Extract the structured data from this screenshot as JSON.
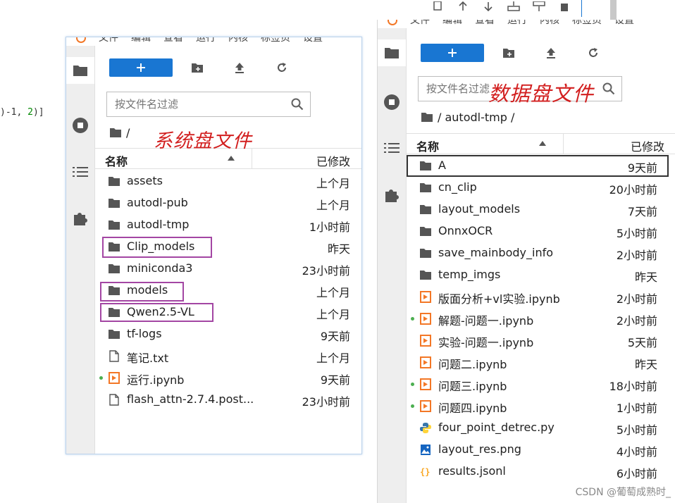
{
  "background": {
    "code_fragment_prefix": ")-1, ",
    "code_fragment_num": "2",
    "code_fragment_suffix": ")]"
  },
  "menu_labels": [
    "文件",
    "编辑",
    "查看",
    "运行",
    "内核",
    "标签页",
    "设置"
  ],
  "left_panel": {
    "filter_placeholder": "按文件名过滤",
    "breadcrumb": "/",
    "annotation": "系统盘文件",
    "column_name": "名称",
    "column_modified": "已修改",
    "rows": [
      {
        "name": "assets",
        "modified": "上个月",
        "type": "folder",
        "running": false
      },
      {
        "name": "autodl-pub",
        "modified": "上个月",
        "type": "folder",
        "running": false
      },
      {
        "name": "autodl-tmp",
        "modified": "1小时前",
        "type": "folder",
        "running": false
      },
      {
        "name": "Clip_models",
        "modified": "昨天",
        "type": "folder",
        "running": false
      },
      {
        "name": "miniconda3",
        "modified": "23小时前",
        "type": "folder",
        "running": false
      },
      {
        "name": "models",
        "modified": "上个月",
        "type": "folder",
        "running": false
      },
      {
        "name": "Qwen2.5-VL",
        "modified": "上个月",
        "type": "folder",
        "running": false
      },
      {
        "name": "tf-logs",
        "modified": "9天前",
        "type": "folder",
        "running": false
      },
      {
        "name": "笔记.txt",
        "modified": "上个月",
        "type": "text",
        "running": false
      },
      {
        "name": "运行.ipynb",
        "modified": "9天前",
        "type": "notebook",
        "running": true
      },
      {
        "name": "flash_attn-2.7.4.post...",
        "modified": "23小时前",
        "type": "text",
        "running": false
      }
    ]
  },
  "right_panel": {
    "filter_placeholder": "按文件名过滤",
    "breadcrumb": "/ autodl-tmp /",
    "annotation": "数据盘文件",
    "column_name": "名称",
    "column_modified": "已修改",
    "rows": [
      {
        "name": "A",
        "modified": "9天前",
        "type": "folder",
        "running": false,
        "selected": true
      },
      {
        "name": "cn_clip",
        "modified": "20小时前",
        "type": "folder",
        "running": false
      },
      {
        "name": "layout_models",
        "modified": "7天前",
        "type": "folder",
        "running": false
      },
      {
        "name": "OnnxOCR",
        "modified": "5小时前",
        "type": "folder",
        "running": false
      },
      {
        "name": "save_mainbody_info",
        "modified": "2小时前",
        "type": "folder",
        "running": false
      },
      {
        "name": "temp_imgs",
        "modified": "昨天",
        "type": "folder",
        "running": false
      },
      {
        "name": "版面分析+vl实验.ipynb",
        "modified": "2小时前",
        "type": "notebook",
        "running": false
      },
      {
        "name": "解题-问题一.ipynb",
        "modified": "2小时前",
        "type": "notebook",
        "running": true
      },
      {
        "name": "实验-问题一.ipynb",
        "modified": "5天前",
        "type": "notebook",
        "running": false
      },
      {
        "name": "问题二.ipynb",
        "modified": "昨天",
        "type": "notebook",
        "running": false
      },
      {
        "name": "问题三.ipynb",
        "modified": "18小时前",
        "type": "notebook",
        "running": true
      },
      {
        "name": "问题四.ipynb",
        "modified": "1小时前",
        "type": "notebook",
        "running": true
      },
      {
        "name": "four_point_detrec.py",
        "modified": "5小时前",
        "type": "python",
        "running": false
      },
      {
        "name": "layout_res.png",
        "modified": "4小时前",
        "type": "image",
        "running": false
      },
      {
        "name": "results.jsonl",
        "modified": "6小时前",
        "type": "json",
        "running": false
      }
    ]
  },
  "watermark": "CSDN @葡萄成熟时_",
  "colors": {
    "accent": "#1976d2",
    "annotation": "#d21f1f",
    "highlight_box": "#a346a3",
    "running_dot": "#4caf50",
    "notebook_icon": "#f37726"
  }
}
